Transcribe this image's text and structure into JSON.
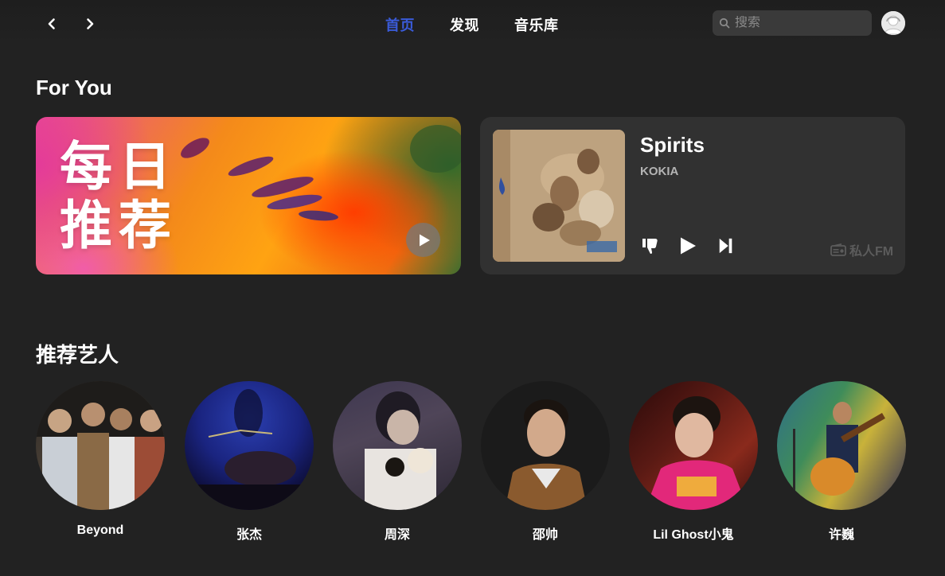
{
  "nav": {
    "back_icon": "chevron-left-icon",
    "forward_icon": "chevron-right-icon",
    "tabs": [
      {
        "label": "首页",
        "active": true
      },
      {
        "label": "发现",
        "active": false
      },
      {
        "label": "音乐库",
        "active": false
      }
    ],
    "search_placeholder": "搜索",
    "accent_color": "#3a5bd9"
  },
  "for_you": {
    "title": "For You",
    "daily": {
      "title_line1": "每日",
      "title_line2": "推荐"
    },
    "fm": {
      "song": "Spirits",
      "artist": "KOKIA",
      "label": "私人FM"
    }
  },
  "artists_section": {
    "title": "推荐艺人",
    "artists": [
      {
        "name": "Beyond"
      },
      {
        "name": "张杰"
      },
      {
        "name": "周深"
      },
      {
        "name": "邵帅"
      },
      {
        "name": "Lil Ghost小鬼"
      },
      {
        "name": "许巍"
      }
    ]
  }
}
